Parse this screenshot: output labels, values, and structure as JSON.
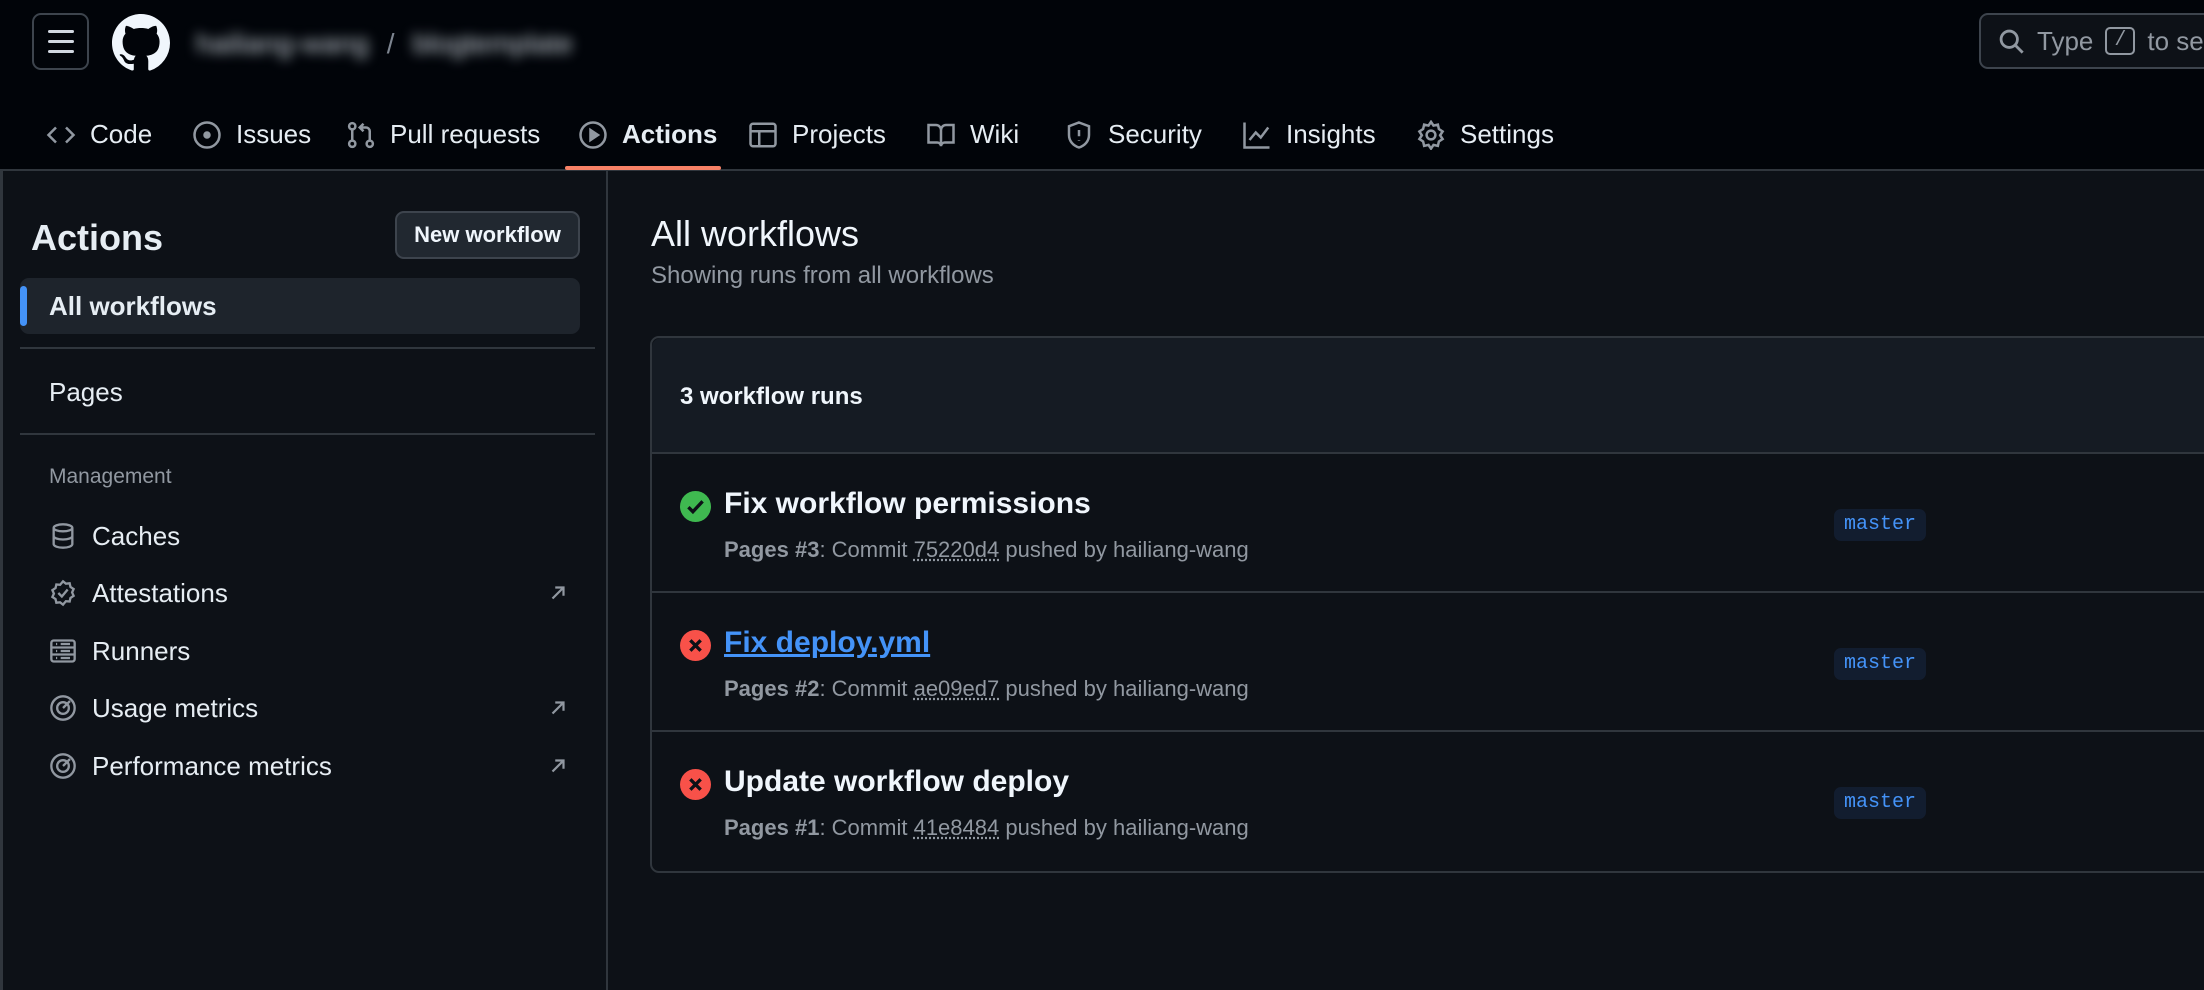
{
  "header": {
    "owner": "hailiang-wang",
    "separator": "/",
    "repo": "blogtemplate",
    "search": {
      "prefix": "Type",
      "key": "/",
      "suffix": "to sear"
    }
  },
  "tabs": [
    {
      "label": "Code",
      "icon": "code-icon"
    },
    {
      "label": "Issues",
      "icon": "issue-icon"
    },
    {
      "label": "Pull requests",
      "icon": "pull-request-icon"
    },
    {
      "label": "Actions",
      "icon": "play-icon",
      "active": true
    },
    {
      "label": "Projects",
      "icon": "table-icon"
    },
    {
      "label": "Wiki",
      "icon": "book-icon"
    },
    {
      "label": "Security",
      "icon": "shield-icon"
    },
    {
      "label": "Insights",
      "icon": "graph-icon"
    },
    {
      "label": "Settings",
      "icon": "gear-icon"
    }
  ],
  "sidebar": {
    "title": "Actions",
    "new_workflow": "New workflow",
    "all_workflows": "All workflows",
    "pages": "Pages",
    "management_label": "Management",
    "management": [
      {
        "label": "Caches",
        "icon": "database-icon"
      },
      {
        "label": "Attestations",
        "icon": "verified-icon",
        "external": true
      },
      {
        "label": "Runners",
        "icon": "server-icon"
      },
      {
        "label": "Usage metrics",
        "icon": "meter-icon",
        "external": true
      },
      {
        "label": "Performance metrics",
        "icon": "meter-icon",
        "external": true
      }
    ]
  },
  "main": {
    "title": "All workflows",
    "subtitle": "Showing runs from all workflows",
    "count": "3 workflow runs",
    "runs": [
      {
        "title": "Fix workflow permissions",
        "status": "success",
        "workflow": "Pages",
        "number": "#3",
        "commit_label": "Commit",
        "sha": "75220d4",
        "pushed_by": "pushed by hailiang-wang",
        "branch": "master"
      },
      {
        "title": "Fix deploy.yml",
        "status": "failure",
        "workflow": "Pages",
        "number": "#2",
        "commit_label": "Commit",
        "sha": "ae09ed7",
        "pushed_by": "pushed by hailiang-wang",
        "branch": "master"
      },
      {
        "title": "Update workflow deploy",
        "status": "failure",
        "workflow": "Pages",
        "number": "#1",
        "commit_label": "Commit",
        "sha": "41e8484",
        "pushed_by": "pushed by hailiang-wang",
        "branch": "master"
      }
    ]
  },
  "colors": {
    "success": "#3fb950",
    "failure": "#f85149",
    "accent": "#4493f8",
    "tab_underline": "#f78166"
  }
}
